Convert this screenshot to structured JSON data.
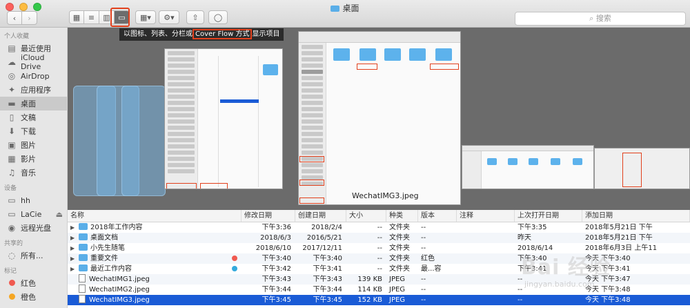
{
  "window": {
    "title": "桌面"
  },
  "toolbar": {
    "back": "‹",
    "forward": "›",
    "view_icons": [
      "▦",
      "≡",
      "▥",
      "▭"
    ],
    "arrange": "▦▾",
    "action": "⚙▾",
    "share": "⇧",
    "tag": "◯",
    "search_placeholder": "搜索"
  },
  "tooltip": {
    "before": "以图标、列表、分栏或",
    "highlight": "Cover Flow 方式",
    "after": "显示项目"
  },
  "sidebar": {
    "favorites_header": "个人收藏",
    "favorites": [
      {
        "label": "最近使用",
        "icon": "recents-icon"
      },
      {
        "label": "iCloud Drive",
        "icon": "cloud-icon"
      },
      {
        "label": "AirDrop",
        "icon": "airdrop-icon"
      },
      {
        "label": "应用程序",
        "icon": "apps-icon"
      },
      {
        "label": "桌面",
        "icon": "desktop-icon"
      },
      {
        "label": "文稿",
        "icon": "document-icon"
      },
      {
        "label": "下载",
        "icon": "download-icon"
      },
      {
        "label": "图片",
        "icon": "photo-icon"
      },
      {
        "label": "影片",
        "icon": "movie-icon"
      },
      {
        "label": "音乐",
        "icon": "music-icon"
      }
    ],
    "devices_header": "设备",
    "devices": [
      {
        "label": "hh",
        "icon": "disk-icon"
      },
      {
        "label": "LaCie",
        "icon": "disk-icon"
      },
      {
        "label": "远程光盘",
        "icon": "disc-icon"
      }
    ],
    "shared_header": "共享的",
    "shared": [
      {
        "label": "所有...",
        "icon": "network-icon"
      }
    ],
    "tags_header": "标记",
    "tags": [
      {
        "label": "红色",
        "color": "#f05a50"
      },
      {
        "label": "橙色",
        "color": "#f5a623"
      }
    ]
  },
  "coverflow": {
    "caption": "WechatIMG3.jpeg"
  },
  "list": {
    "columns": [
      "名称",
      "修改日期",
      "创建日期",
      "大小",
      "种类",
      "版本",
      "注释",
      "上次打开日期",
      "添加日期"
    ],
    "rows": [
      {
        "name": "2018年工作内容",
        "type": "folder",
        "mod": "下午3:36",
        "created": "2018/2/4",
        "size": "--",
        "kind": "文件夹",
        "tag_text": "--",
        "tag_color": "",
        "version": "",
        "comment": "",
        "opened": "下午3:35",
        "added": "2018年5月21日 下午"
      },
      {
        "name": "桌面文档",
        "type": "folder",
        "mod": "2018/6/3",
        "created": "2016/5/21",
        "size": "--",
        "kind": "文件夹",
        "tag_text": "--",
        "tag_color": "",
        "version": "",
        "comment": "",
        "opened": "昨天",
        "added": "2018年5月21日 下午"
      },
      {
        "name": "小先生随笔",
        "type": "folder",
        "mod": "2018/6/10",
        "created": "2017/12/11",
        "size": "--",
        "kind": "文件夹",
        "tag_text": "--",
        "tag_color": "",
        "version": "",
        "comment": "",
        "opened": "2018/6/14",
        "added": "2018年6月3日 上午11"
      },
      {
        "name": "重要文件",
        "type": "folder",
        "mod": "下午3:40",
        "created": "下午3:40",
        "size": "--",
        "kind": "文件夹",
        "tag_text": "红色",
        "tag_color": "#f05a50",
        "version": "",
        "comment": "",
        "opened": "下午3:40",
        "added": "今天 下午3:40"
      },
      {
        "name": "最近工作内容",
        "type": "folder",
        "mod": "下午3:42",
        "created": "下午3:41",
        "size": "--",
        "kind": "文件夹",
        "tag_text": "最...容",
        "tag_color": "#34aadc",
        "version": "",
        "comment": "",
        "opened": "下午3:41",
        "added": "今天 下午3:41"
      },
      {
        "name": "WechatIMG1.jpeg",
        "type": "file",
        "mod": "下午3:43",
        "created": "下午3:43",
        "size": "139 KB",
        "kind": "JPEG",
        "tag_text": "--",
        "tag_color": "",
        "version": "",
        "comment": "",
        "opened": "--",
        "added": "今天 下午3:47"
      },
      {
        "name": "WechatIMG2.jpeg",
        "type": "file",
        "mod": "下午3:44",
        "created": "下午3:44",
        "size": "114 KB",
        "kind": "JPEG",
        "tag_text": "--",
        "tag_color": "",
        "version": "",
        "comment": "",
        "opened": "--",
        "added": "今天 下午3:48"
      },
      {
        "name": "WechatIMG3.jpeg",
        "type": "file",
        "mod": "下午3:45",
        "created": "下午3:45",
        "size": "152 KB",
        "kind": "JPEG",
        "tag_text": "--",
        "tag_color": "",
        "version": "",
        "comment": "",
        "opened": "--",
        "added": "今天 下午3:48",
        "selected": true
      }
    ]
  },
  "watermark": {
    "main": "Bai 经验",
    "sub": "jingyan.baidu.com"
  }
}
